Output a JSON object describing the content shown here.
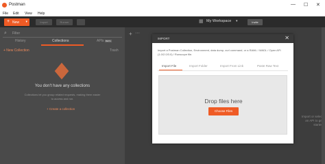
{
  "window": {
    "title": "Postman",
    "min_glyph": "—",
    "max_glyph": "☐",
    "close_glyph": "✕"
  },
  "menu": [
    "File",
    "Edit",
    "View",
    "Help"
  ],
  "toolbar": {
    "new_label": "New",
    "new_plus": "+",
    "caret": "▾",
    "import_label": "Import",
    "runner_label": "Runner",
    "workspace_label": "My Workspace",
    "invite_label": "Invite"
  },
  "sidebar": {
    "search_placeholder": "Filter",
    "tabs": [
      "History",
      "Collections",
      "APIs"
    ],
    "beta_badge": "BETA",
    "new_collection": "+ New Collection",
    "trash": "Trash",
    "empty_title": "You don't have any collections",
    "empty_desc": "Collections let you group related requests, making them easier to access and run.",
    "create_link": "+ Create a collection"
  },
  "main": {
    "new_tab": "+",
    "more": "···",
    "right_text": "Import or select\nan API to get\nstarted"
  },
  "modal": {
    "title": "IMPORT",
    "close": "✕",
    "description": "Import a Postman Collection, Environment, data dump, curl command, or a RAML / WADL / Open API (1.0/2.0/3.0) / Runscope file.",
    "tabs": [
      "Import File",
      "Import Folder",
      "Import From Link",
      "Paste Raw Text"
    ],
    "active_tab": 0,
    "drop_text": "Drop files here",
    "choose_button": "Choose Files"
  },
  "colors": {
    "accent": "#ef5b25",
    "dark": "#2b2b2b",
    "sidebar": "#4a4a4a"
  }
}
